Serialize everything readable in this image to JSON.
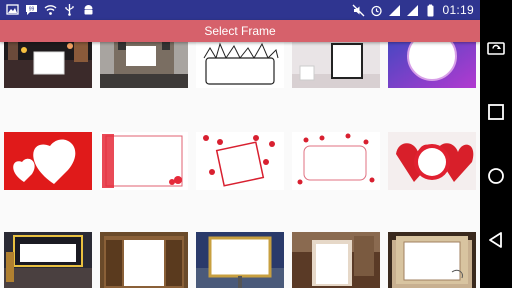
{
  "status_bar": {
    "time": "01:19",
    "left_icons": [
      "image-icon",
      "chat-icon",
      "wifi-icon",
      "usb-icon",
      "android-icon"
    ],
    "right_icons": [
      "mute-icon",
      "alarm-icon",
      "signal-icon",
      "signal-icon",
      "battery-icon"
    ]
  },
  "app_bar": {
    "title": "Select Frame"
  },
  "frames": [
    {
      "name": "frame-city-night"
    },
    {
      "name": "frame-building-street"
    },
    {
      "name": "frame-doodle-city"
    },
    {
      "name": "frame-wall-photo"
    },
    {
      "name": "frame-purple-circle"
    },
    {
      "name": "frame-red-hearts"
    },
    {
      "name": "frame-heart-border"
    },
    {
      "name": "frame-tilted-hearts"
    },
    {
      "name": "frame-heart-confetti"
    },
    {
      "name": "frame-heart-circle"
    },
    {
      "name": "frame-marquee-sign"
    },
    {
      "name": "frame-wooden-window"
    },
    {
      "name": "frame-gold-billboard"
    },
    {
      "name": "frame-wood-photo"
    },
    {
      "name": "frame-vintage-paper"
    }
  ],
  "nav_bar": {
    "buttons": [
      "rotate-screen-icon",
      "recents-icon",
      "home-icon",
      "back-icon"
    ]
  },
  "colors": {
    "status_bar": "#2f3590",
    "app_bar": "#d6616b",
    "background": "#fafafa"
  }
}
